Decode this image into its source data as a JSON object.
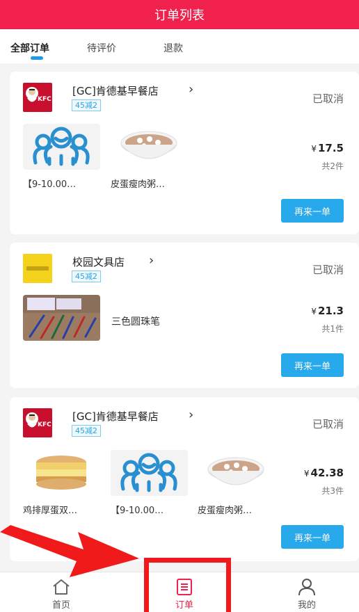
{
  "header": {
    "title": "订单列表"
  },
  "tabs": [
    {
      "label": "全部订单",
      "active": true
    },
    {
      "label": "待评价",
      "active": false
    },
    {
      "label": "退款",
      "active": false
    }
  ],
  "orders": [
    {
      "store": "[GC]肯德基早餐店",
      "logo": "kfc-logo",
      "promo": "45减2",
      "status": "已取消",
      "price_symbol": "¥",
      "price": "17.5",
      "quantity": "共2件",
      "reorder_label": "再来一单",
      "items": [
        {
          "label": "【9-10.00…",
          "image": "placeholder-people-icon"
        },
        {
          "label": "皮蛋瘦肉粥…",
          "image": "congee-bowl"
        }
      ]
    },
    {
      "store": "校园文具店",
      "logo": "stationery-store-logo",
      "promo": "45减2",
      "status": "已取消",
      "price_symbol": "¥",
      "price": "21.3",
      "quantity": "共1件",
      "reorder_label": "再来一单",
      "items": [
        {
          "label": "三色圆珠笔",
          "image": "ballpoint-pens"
        }
      ]
    },
    {
      "store": "[GC]肯德基早餐店",
      "logo": "kfc-logo",
      "promo": "45减2",
      "status": "已取消",
      "price_symbol": "¥",
      "price": "42.38",
      "quantity": "共3件",
      "reorder_label": "再来一单",
      "items": [
        {
          "label": "鸡排厚蛋双…",
          "image": "chicken-egg-sandwich"
        },
        {
          "label": "【9-10.00…",
          "image": "placeholder-people-icon"
        },
        {
          "label": "皮蛋瘦肉粥…",
          "image": "congee-bowl"
        }
      ]
    }
  ],
  "bottom_nav": [
    {
      "label": "首页",
      "icon": "home-icon",
      "active": false
    },
    {
      "label": "订单",
      "icon": "order-list-icon",
      "active": true
    },
    {
      "label": "我的",
      "icon": "user-icon",
      "active": false
    }
  ],
  "colors": {
    "brand": "#f0224d",
    "accent": "#27a9ec",
    "annotation": "#f01a1a"
  }
}
